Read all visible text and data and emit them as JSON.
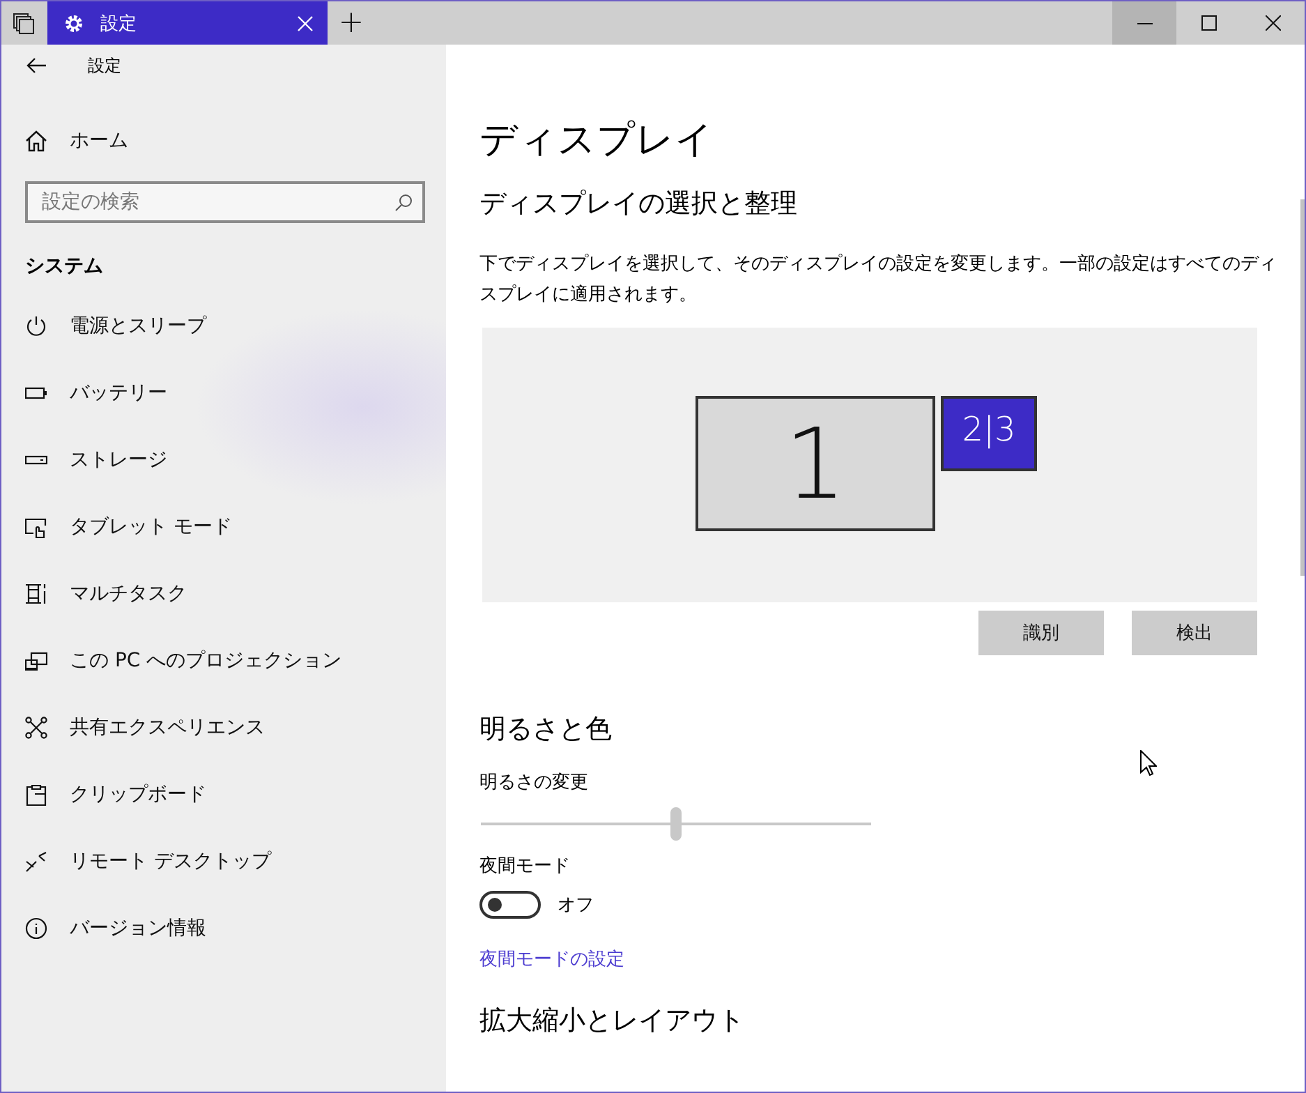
{
  "titlebar": {
    "tab_title": "設定",
    "new_tab": "+"
  },
  "sidebar": {
    "header": "設定",
    "home": "ホーム",
    "search": {
      "placeholder": "設定の検索"
    },
    "section": "システム",
    "items": [
      {
        "label": "電源とスリープ"
      },
      {
        "label": "バッテリー"
      },
      {
        "label": "ストレージ"
      },
      {
        "label": "タブレット モード"
      },
      {
        "label": "マルチタスク"
      },
      {
        "label": "この PC へのプロジェクション"
      },
      {
        "label": "共有エクスペリエンス"
      },
      {
        "label": "クリップボード"
      },
      {
        "label": "リモート デスクトップ"
      },
      {
        "label": "バージョン情報"
      }
    ]
  },
  "content": {
    "title": "ディスプレイ",
    "arrange_heading": "ディスプレイの選択と整理",
    "description": "下でディスプレイを選択して、そのディスプレイの設定を変更します。一部の設定はすべてのディスプレイに適用されます。",
    "monitors": [
      {
        "label": "1",
        "selected": false
      },
      {
        "label": "2|3",
        "selected": true
      }
    ],
    "buttons": [
      "識別",
      "検出"
    ],
    "brightness_heading": "明るさと色",
    "brightness_label": "明るさの変更",
    "brightness": {
      "level": 0.5
    },
    "night_mode_label": "夜間モード",
    "night_mode": {
      "on": false,
      "state_text": "オフ"
    },
    "night_link": "夜間モードの設定",
    "scale_heading": "拡大縮小とレイアウト"
  }
}
